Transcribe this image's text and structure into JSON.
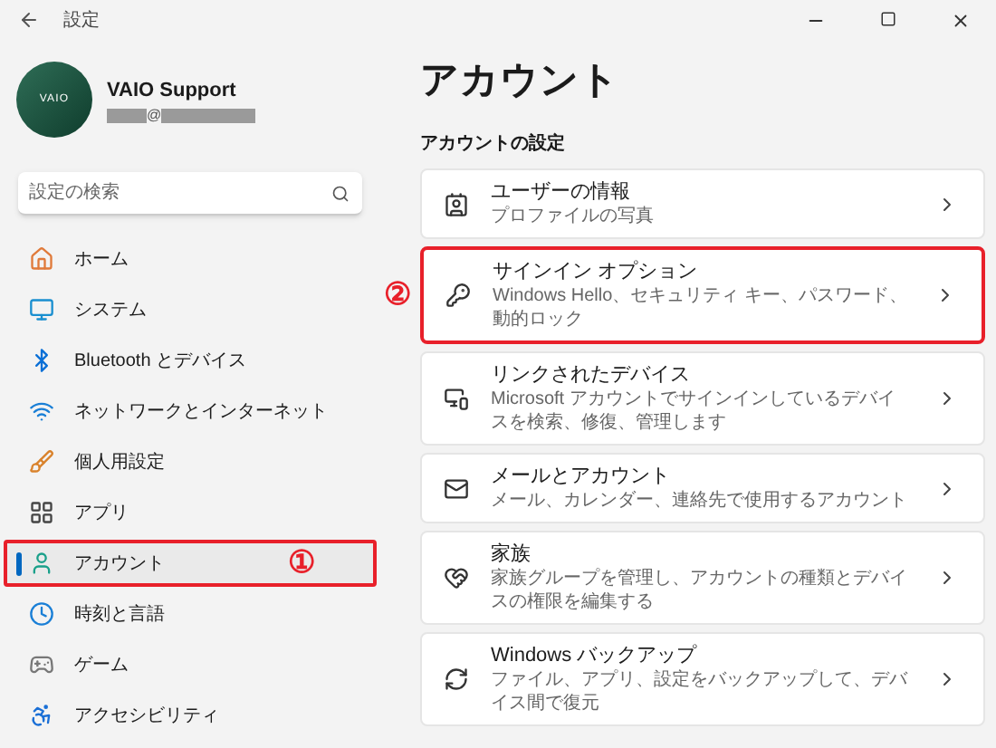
{
  "window": {
    "title": "設定"
  },
  "profile": {
    "name": "VAIO Support",
    "avatar_text": "VAIO",
    "email_separator": "@"
  },
  "search": {
    "placeholder": "設定の検索"
  },
  "nav": [
    {
      "label": "ホーム",
      "selected": false
    },
    {
      "label": "システム",
      "selected": false
    },
    {
      "label": "Bluetooth とデバイス",
      "selected": false
    },
    {
      "label": "ネットワークとインターネット",
      "selected": false
    },
    {
      "label": "個人用設定",
      "selected": false
    },
    {
      "label": "アプリ",
      "selected": false
    },
    {
      "label": "アカウント",
      "selected": true,
      "marker": "①"
    },
    {
      "label": "時刻と言語",
      "selected": false
    },
    {
      "label": "ゲーム",
      "selected": false
    },
    {
      "label": "アクセシビリティ",
      "selected": false
    }
  ],
  "page": {
    "title": "アカウント",
    "section": "アカウントの設定"
  },
  "cards": [
    {
      "title": "ユーザーの情報",
      "description": "プロファイルの写真"
    },
    {
      "title": "サインイン オプション",
      "description": "Windows Hello、セキュリティ キー、パスワード、動的ロック",
      "marker": "②"
    },
    {
      "title": "リンクされたデバイス",
      "description": "Microsoft アカウントでサインインしているデバイスを検索、修復、管理します"
    },
    {
      "title": "メールとアカウント",
      "description": "メール、カレンダー、連絡先で使用するアカウント"
    },
    {
      "title": "家族",
      "description": "家族グループを管理し、アカウントの種類とデバイスの権限を編集する"
    },
    {
      "title": "Windows バックアップ",
      "description": "ファイル、アプリ、設定をバックアップして、デバイス間で復元"
    }
  ]
}
